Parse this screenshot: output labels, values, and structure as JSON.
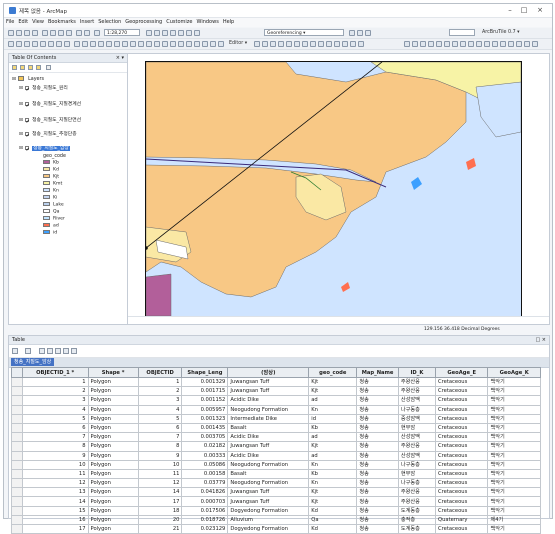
{
  "window": {
    "title": "제목 없음 - ArcMap"
  },
  "menu": [
    "File",
    "Edit",
    "View",
    "Bookmarks",
    "Insert",
    "Selection",
    "Geoprocessing",
    "Customize",
    "Windows",
    "Help"
  ],
  "toolbar": {
    "scale": "1:28,270",
    "georeferencing_label": "Georeferencing ▾",
    "editor_label": "Editor ▾",
    "arctile_label": "ArcBruTile 0.7 ▾"
  },
  "toc": {
    "title": "Table Of Contents",
    "layers_label": "Layers",
    "items": [
      "청송_지질도_원리",
      "청송_지질도_지질경계선",
      "청송_지질도_지질단면선",
      "청송_지질도_추정단층",
      "청송_지질도_암상"
    ],
    "legend_field": "geo_code",
    "legend": [
      {
        "code": "Kb",
        "color": "#b25f9a"
      },
      {
        "code": "Kd",
        "color": "#fae8a4"
      },
      {
        "code": "Kjt",
        "color": "#f8c885"
      },
      {
        "code": "Kmt",
        "color": "#f7f3a6"
      },
      {
        "code": "Kn",
        "color": "#cfe4ff"
      },
      {
        "code": "Ki",
        "color": "#c5d5f0"
      },
      {
        "code": "Lake",
        "color": "#bcd2ee"
      },
      {
        "code": "Qa",
        "color": "#ffffff"
      },
      {
        "code": "River",
        "color": "#bfe3ff"
      },
      {
        "code": "ad",
        "color": "#ff6f50"
      },
      {
        "code": "id",
        "color": "#3da0ff"
      }
    ]
  },
  "status": {
    "coords": "129.156  36.418 Decimal Degrees"
  },
  "table": {
    "title": "Table",
    "tab_label": "청송_지질도_암상",
    "columns": [
      "OBJECTID_1 *",
      "Shape *",
      "OBJECTID",
      "Shape_Leng",
      "(암상)",
      "geo_code",
      "Map_Name",
      "ID_K",
      "GeoAge_E",
      "GeoAge_K"
    ],
    "rows": [
      [
        "1",
        "Polygon",
        "1",
        "0.001329",
        "Juwangsan Tuff",
        "Kjt",
        "청송",
        "주왕산응",
        "Cretaceous",
        "백악기"
      ],
      [
        "2",
        "Polygon",
        "2",
        "0.001715",
        "Juwangsan Tuff",
        "Kjt",
        "청송",
        "주왕산응",
        "Cretaceous",
        "백악기"
      ],
      [
        "3",
        "Polygon",
        "3",
        "0.001152",
        "Acidic Dike",
        "ad",
        "청송",
        "산성암맥",
        "Cretaceous",
        "백악기"
      ],
      [
        "4",
        "Polygon",
        "4",
        "0.005957",
        "Neogudong Formation",
        "Kn",
        "청송",
        "나구동층",
        "Cretaceous",
        "백악기"
      ],
      [
        "5",
        "Polygon",
        "5",
        "0.001323",
        "Intermediate Dike",
        "id",
        "청송",
        "중성암맥",
        "Cretaceous",
        "백악기"
      ],
      [
        "6",
        "Polygon",
        "6",
        "0.001435",
        "Basalt",
        "Kb",
        "청송",
        "현무암",
        "Cretaceous",
        "백악기"
      ],
      [
        "7",
        "Polygon",
        "7",
        "0.003705",
        "Acidic Dike",
        "ad",
        "청송",
        "산성암맥",
        "Cretaceous",
        "백악기"
      ],
      [
        "8",
        "Polygon",
        "8",
        "0.02182",
        "Juwangsan Tuff",
        "Kjt",
        "청송",
        "주왕산응",
        "Cretaceous",
        "백악기"
      ],
      [
        "9",
        "Polygon",
        "9",
        "0.00333",
        "Acidic Dike",
        "ad",
        "청송",
        "산성암맥",
        "Cretaceous",
        "백악기"
      ],
      [
        "10",
        "Polygon",
        "10",
        "0.05086",
        "Neogudong Formation",
        "Kn",
        "청송",
        "나구동층",
        "Cretaceous",
        "백악기"
      ],
      [
        "11",
        "Polygon",
        "11",
        "0.00158",
        "Basalt",
        "Kb",
        "청송",
        "현무암",
        "Cretaceous",
        "백악기"
      ],
      [
        "12",
        "Polygon",
        "12",
        "0.03779",
        "Neogudong Formation",
        "Kn",
        "청송",
        "나구동층",
        "Cretaceous",
        "백악기"
      ],
      [
        "13",
        "Polygon",
        "14",
        "0.041826",
        "Juwangsan Tuff",
        "Kjt",
        "청송",
        "주왕산응",
        "Cretaceous",
        "백악기"
      ],
      [
        "14",
        "Polygon",
        "17",
        "0.000703",
        "Juwangsan Tuff",
        "Kjt",
        "청송",
        "주왕산응",
        "Cretaceous",
        "백악기"
      ],
      [
        "15",
        "Polygon",
        "18",
        "0.017506",
        "Dogyedong Formation",
        "Kd",
        "청송",
        "도계동층",
        "Cretaceous",
        "백악기"
      ],
      [
        "16",
        "Polygon",
        "20",
        "0.018726",
        "Alluvium",
        "Qa",
        "청송",
        "충적층",
        "Quaternary",
        "제4기"
      ],
      [
        "17",
        "Polygon",
        "21",
        "0.023129",
        "Dogyedong Formation",
        "Kd",
        "청송",
        "도계동층",
        "Cretaceous",
        "백악기"
      ]
    ]
  }
}
